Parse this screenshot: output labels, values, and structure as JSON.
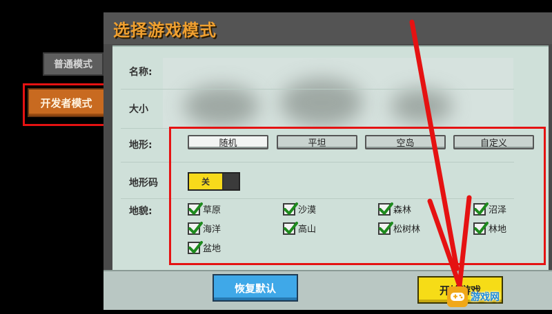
{
  "dialog": {
    "title": "选择游戏模式"
  },
  "tabs": {
    "normal": "普通模式",
    "developer": "开发者模式"
  },
  "fields": {
    "name_label": "名称:",
    "size_label": "大小",
    "terrain_label": "地形:",
    "terrain_code_label": "地形码",
    "landform_label": "地貌:"
  },
  "terrain_options": [
    "随机",
    "平坦",
    "空岛",
    "自定义"
  ],
  "terrain_selected": "随机",
  "terrain_code_toggle": {
    "label": "关",
    "on": false
  },
  "landforms": [
    {
      "label": "草原",
      "checked": true
    },
    {
      "label": "沙漠",
      "checked": true
    },
    {
      "label": "森林",
      "checked": true
    },
    {
      "label": "沼泽",
      "checked": true
    },
    {
      "label": "海洋",
      "checked": true
    },
    {
      "label": "高山",
      "checked": true
    },
    {
      "label": "松树林",
      "checked": true
    },
    {
      "label": "林地",
      "checked": true
    },
    {
      "label": "盆地",
      "checked": true
    }
  ],
  "footer": {
    "reset": "恢复默认",
    "start": "开始游戏"
  },
  "watermark": {
    "text": "游戏网"
  },
  "colors": {
    "highlight": "#e51212",
    "accent": "#f0a030",
    "start": "#f6dc17",
    "reset": "#3fa8e8"
  }
}
